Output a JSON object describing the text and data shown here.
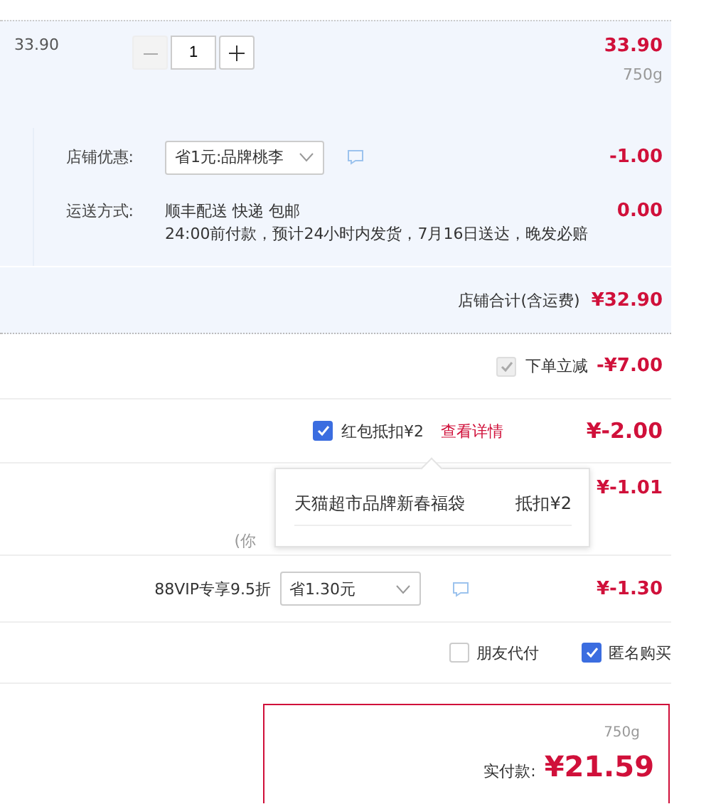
{
  "item": {
    "unit_price": "33.90",
    "quantity": "1",
    "total": "33.90",
    "weight": "750g",
    "decrement_disabled": true
  },
  "shop_discount": {
    "label": "店铺优惠:",
    "selected_option": "省1元:品牌桃李",
    "amount": "-1.00"
  },
  "shipping": {
    "label": "运送方式:",
    "method": "顺丰配送 快递 包邮",
    "note": "24:00前付款，预计24小时内发货，7月16日送达，晚发必赔",
    "amount": "0.00"
  },
  "shop_total": {
    "label": "店铺合计(含运费)",
    "amount": "¥32.90"
  },
  "instant_discount": {
    "label": "下单立减",
    "checked": true,
    "disabled": true,
    "amount": "-¥7.00"
  },
  "red_packet": {
    "label": "红包抵扣¥2",
    "checked": true,
    "link": "查看详情",
    "amount": "¥-2.00"
  },
  "red_packet_popup": {
    "name": "天猫超市品牌新春福袋",
    "deduction": "抵扣¥2"
  },
  "other_discount": {
    "note": "(你",
    "amount": "¥-1.01"
  },
  "vip_discount": {
    "label": "88VIP专享9.5折",
    "selected_option": "省1.30元",
    "amount": "¥-1.30"
  },
  "options": [
    {
      "label": "朋友代付",
      "checked": false
    },
    {
      "label": "匿名购买",
      "checked": true
    }
  ],
  "payment": {
    "weight": "750g",
    "label": "实付款:",
    "amount": "¥21.59"
  }
}
